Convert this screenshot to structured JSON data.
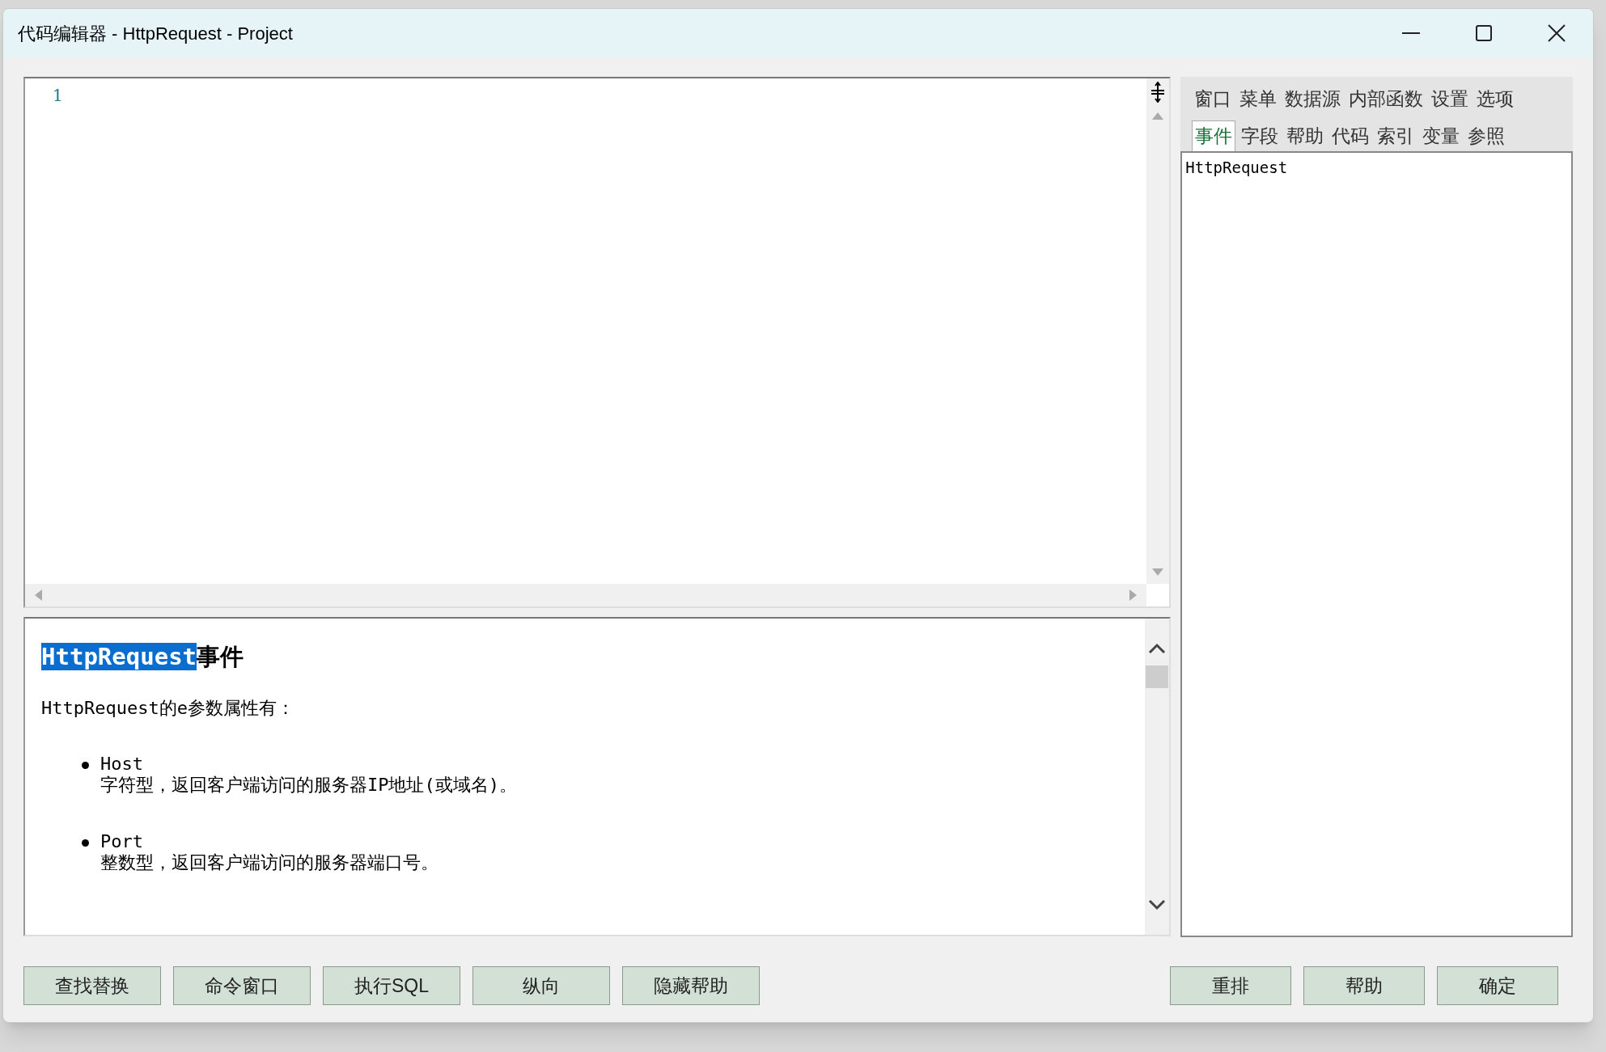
{
  "window": {
    "title": "代码编辑器 - HttpRequest - Project"
  },
  "editor": {
    "line_numbers": [
      "1"
    ]
  },
  "help": {
    "heading": [
      {
        "text": "HttpRequest",
        "selected": true
      },
      {
        "text": "事件",
        "selected": false
      }
    ],
    "intro": "HttpRequest的e参数属性有：",
    "items": [
      {
        "name": "Host",
        "description": "字符型，返回客户端访问的服务器IP地址(或域名)。"
      },
      {
        "name": "Port",
        "description": "整数型，返回客户端访问的服务器端口号。"
      }
    ]
  },
  "tab_rows": [
    [
      {
        "label": "窗口",
        "selected": false
      },
      {
        "label": "菜单",
        "selected": false
      },
      {
        "label": "数据源",
        "selected": false
      },
      {
        "label": "内部函数",
        "selected": false
      },
      {
        "label": "设置",
        "selected": false
      },
      {
        "label": "选项",
        "selected": false
      }
    ],
    [
      {
        "label": "事件",
        "selected": true
      },
      {
        "label": "字段",
        "selected": false
      },
      {
        "label": "帮助",
        "selected": false
      },
      {
        "label": "代码",
        "selected": false
      },
      {
        "label": "索引",
        "selected": false
      },
      {
        "label": "变量",
        "selected": false
      },
      {
        "label": "参照",
        "selected": false
      }
    ]
  ],
  "list": {
    "items": [
      "HttpRequest"
    ]
  },
  "left_buttons": [
    "查找替换",
    "命令窗口",
    "执行SQL",
    "纵向",
    "隐藏帮助"
  ],
  "right_buttons": [
    "重排",
    "帮助",
    "确定"
  ]
}
